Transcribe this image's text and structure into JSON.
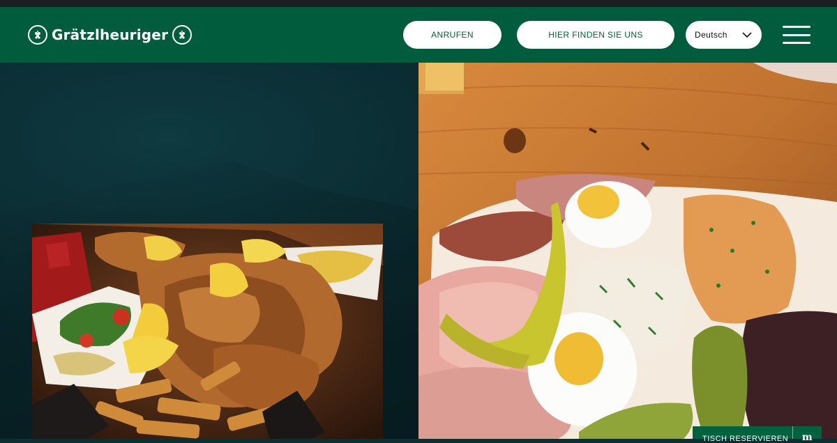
{
  "brand": {
    "name": "Grätzlheuriger"
  },
  "nav": {
    "call_label": "ANRUFEN",
    "find_label": "HIER FINDEN SIE UNS",
    "language": {
      "selected": "Deutsch"
    }
  },
  "icons": {
    "logo_badge": "grape-icon",
    "language_chevron": "chevron-down-icon",
    "menu": "hamburger-menu-icon",
    "reserve_brand": "m-logo-icon"
  },
  "images": {
    "left": "schnitzel-plate-photo",
    "right": "cold-cuts-platter-photo"
  },
  "reserve": {
    "label": "TISCH RESERVIEREN",
    "icon_text": "m"
  },
  "colors": {
    "header": "#005c3c",
    "background": "#0b2f33",
    "pill": "#ffffff",
    "pill_text": "#006040"
  }
}
